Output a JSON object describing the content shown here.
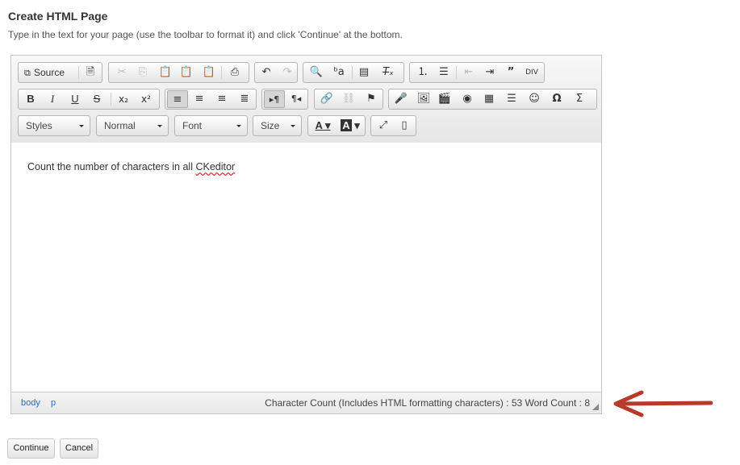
{
  "page": {
    "title": "Create HTML Page",
    "instructions": "Type in the text for your page (use the toolbar to format it) and click 'Continue' at the bottom."
  },
  "toolbar": {
    "source_label": "Source",
    "styles_label": "Styles",
    "format_label": "Normal",
    "font_label": "Font",
    "size_label": "Size"
  },
  "editor": {
    "text_before": "Count the number of characters in all ",
    "text_misspelled": "CKeditor"
  },
  "statusbar": {
    "path": [
      "body",
      "p"
    ],
    "count_text": "Character Count (Includes HTML formatting characters) : 53 Word Count : 8"
  },
  "buttons": {
    "continue": "Continue",
    "cancel": "Cancel"
  },
  "colors": {
    "annotation_arrow": "#b83a2a",
    "path_link": "#2e6ab7"
  }
}
